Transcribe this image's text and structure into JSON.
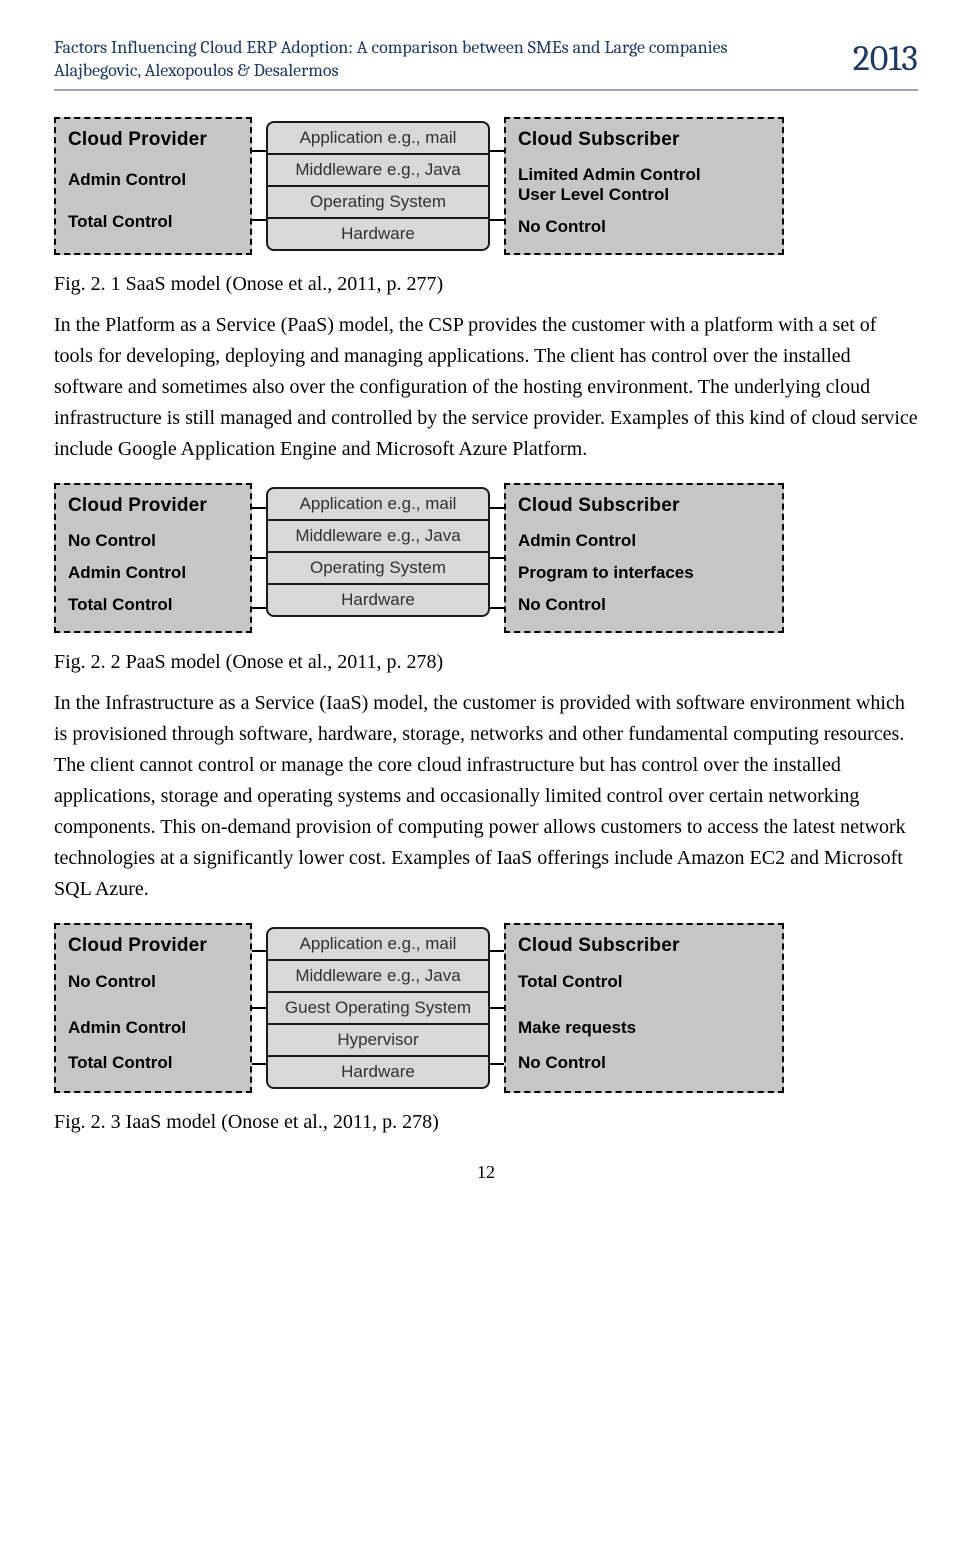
{
  "header": {
    "title_line1": "Factors Influencing Cloud ERP Adoption: A comparison between SMEs and Large companies",
    "title_line2": "Alajbegovic, Alexopoulos & Desalermos",
    "year": "2013"
  },
  "diagram1": {
    "provider_title": "Cloud Provider",
    "subscriber_title": "Cloud Subscriber",
    "left": [
      "Admin Control",
      "Total Control"
    ],
    "right": [
      "Limited Admin Control\nUser Level Control",
      "No Control"
    ],
    "stack": [
      "Application e.g., mail",
      "Middleware e.g., Java",
      "Operating System",
      "Hardware"
    ]
  },
  "caption1": "Fig. 2. 1 SaaS model (Onose et al., 2011, p. 277)",
  "para1": "In the Platform as a Service (PaaS) model, the CSP provides the customer with a platform with a set of tools for developing, deploying and managing applications. The client has control over the installed software and sometimes also over the configuration of the hosting environment. The underlying cloud infrastructure is still managed and controlled by the service provider. Examples of this kind of cloud service include Google Application Engine and Microsoft Azure Platform.",
  "diagram2": {
    "provider_title": "Cloud Provider",
    "subscriber_title": "Cloud Subscriber",
    "left": [
      "No Control",
      "Admin Control",
      "Total Control"
    ],
    "right": [
      "Admin Control",
      "Program to interfaces",
      "No Control"
    ],
    "stack": [
      "Application e.g., mail",
      "Middleware e.g., Java",
      "Operating System",
      "Hardware"
    ]
  },
  "caption2": "Fig. 2. 2 PaaS model (Onose et al., 2011, p. 278)",
  "para2": "In the Infrastructure as a Service (IaaS) model, the customer is provided with software environment which is provisioned through software, hardware, storage, networks and other fundamental computing resources. The client cannot control or manage the core cloud infrastructure but has control over the installed applications, storage and operating systems and occasionally limited control over certain networking components. This on-demand provision of computing power allows customers to access the latest network technologies at a significantly lower cost. Examples of IaaS offerings include Amazon EC2 and Microsoft SQL Azure.",
  "diagram3": {
    "provider_title": "Cloud Provider",
    "subscriber_title": "Cloud Subscriber",
    "left": [
      "No Control",
      "Admin Control",
      "Total Control"
    ],
    "right": [
      "Total Control",
      "Make requests",
      "No Control"
    ],
    "stack": [
      "Application e.g., mail",
      "Middleware e.g., Java",
      "Guest Operating System",
      "Hypervisor",
      "Hardware"
    ]
  },
  "caption3": "Fig. 2. 3 IaaS model (Onose et al., 2011, p. 278)",
  "page_number": "12"
}
